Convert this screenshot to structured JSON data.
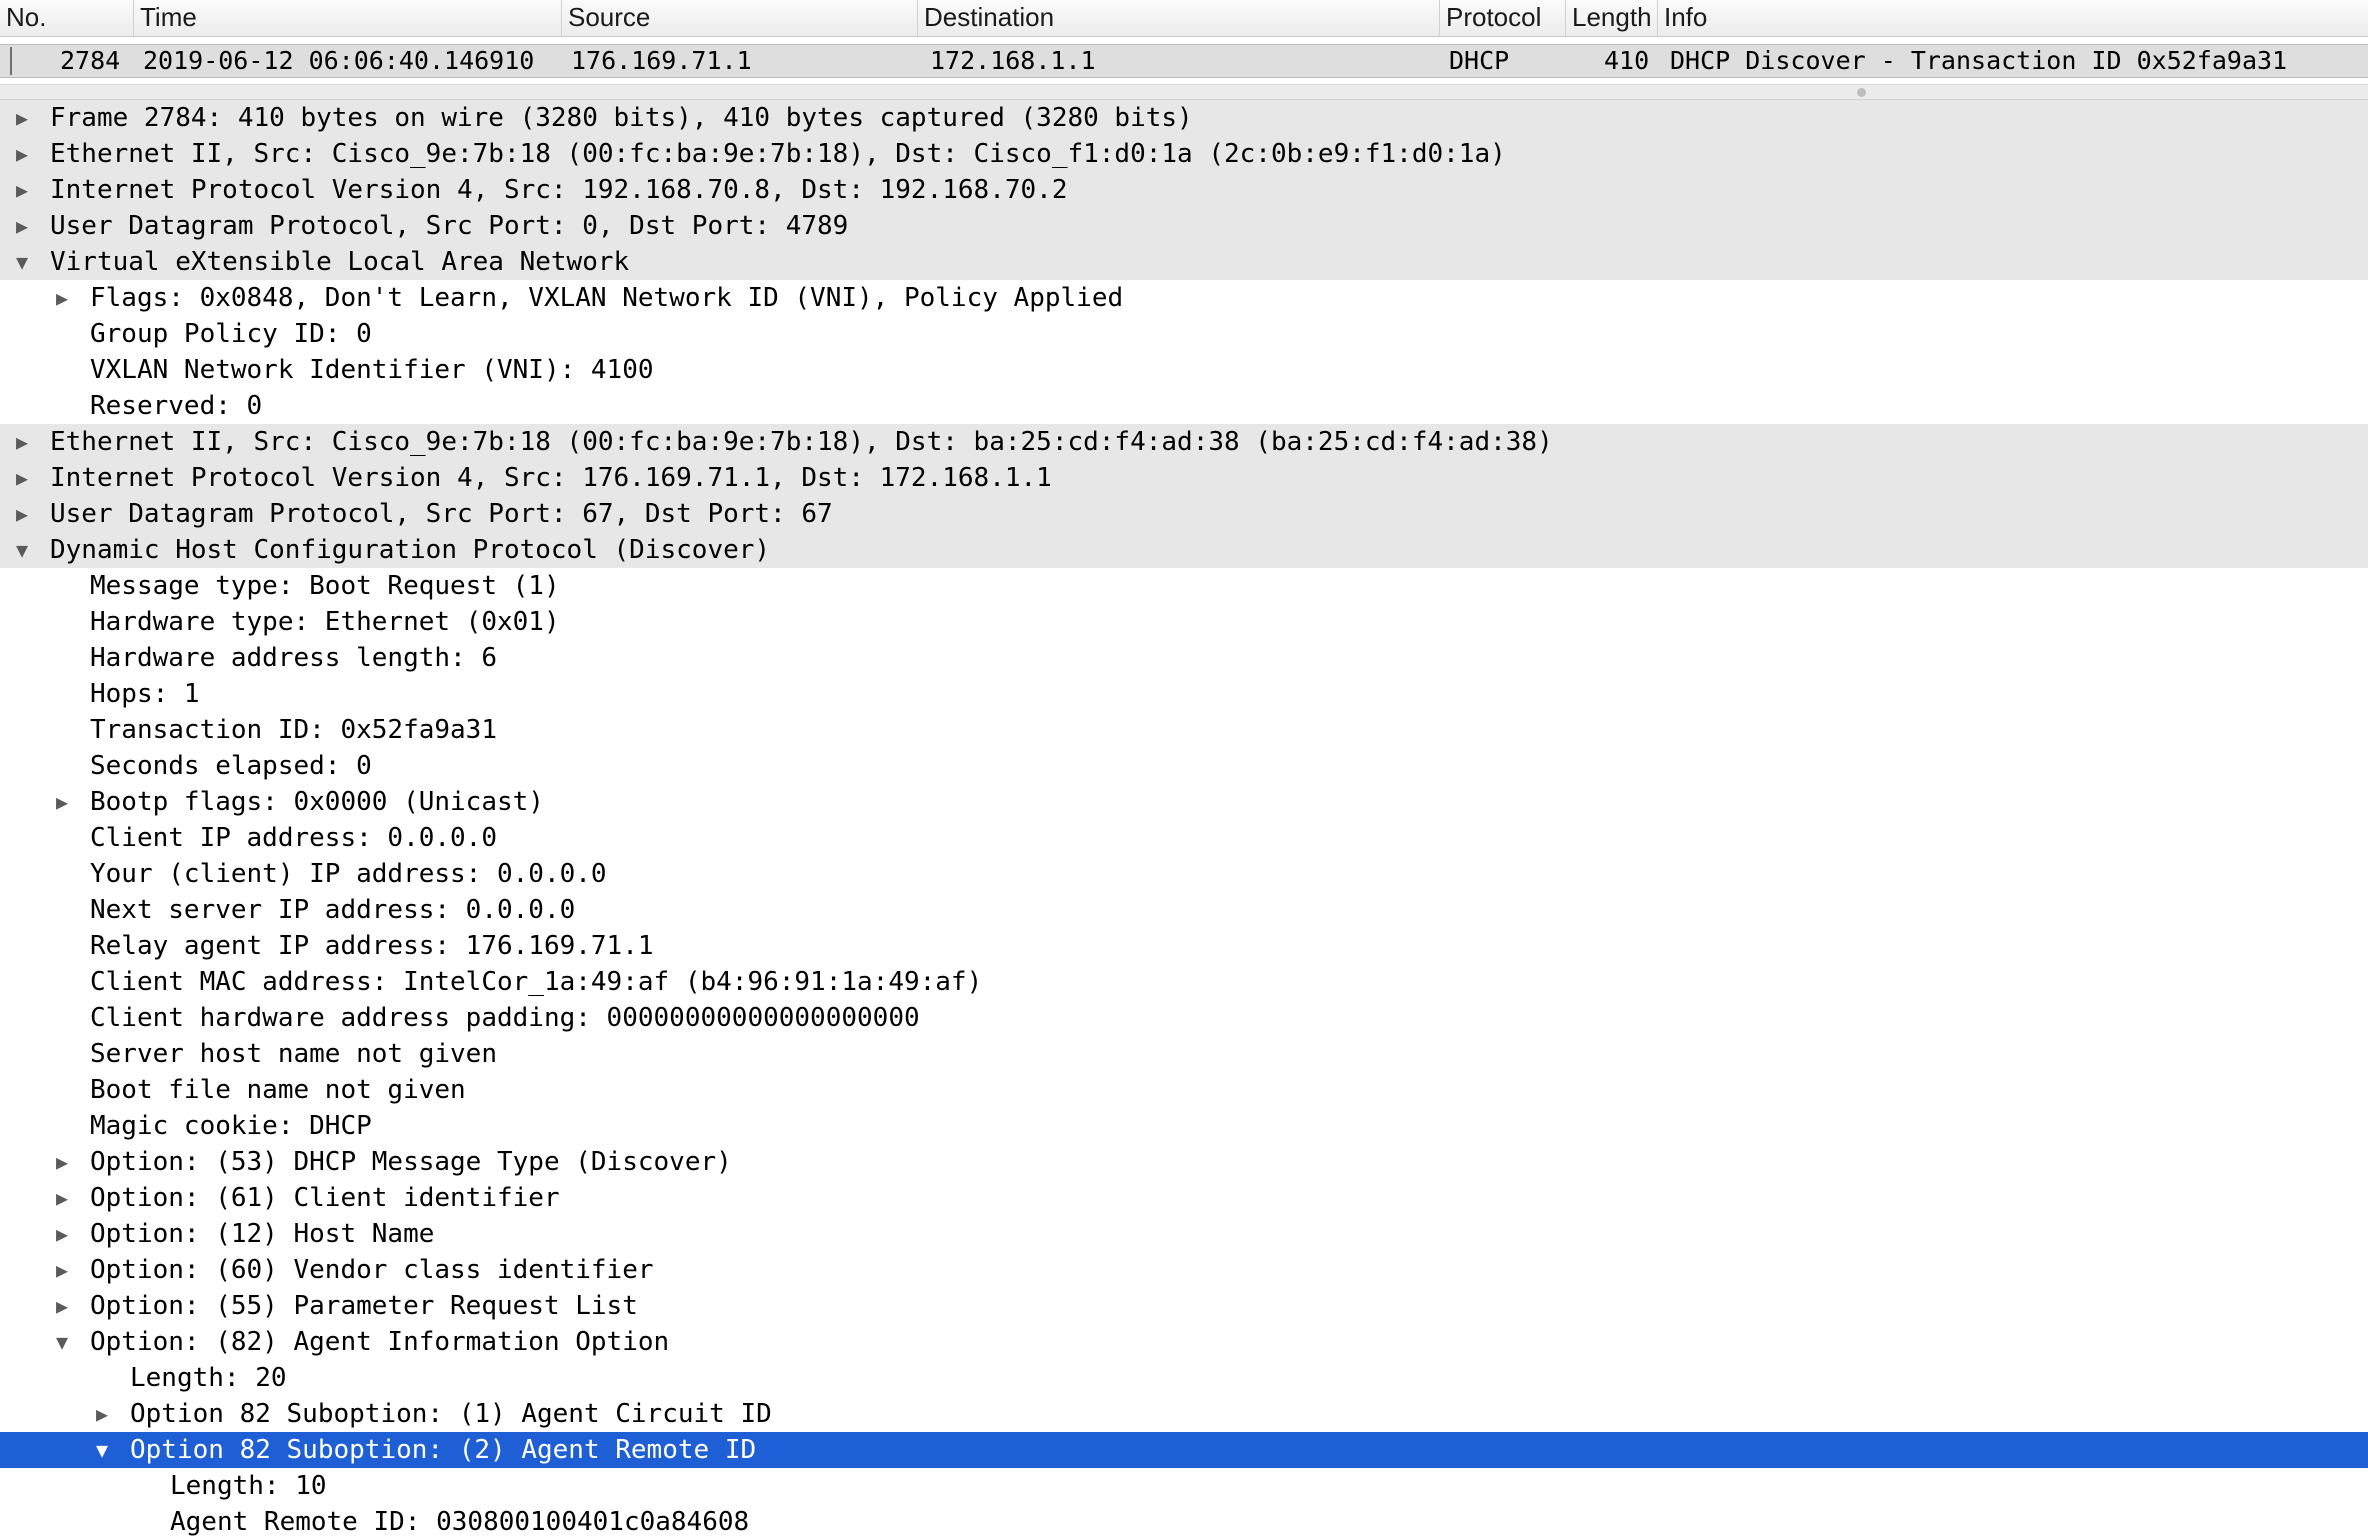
{
  "columns": {
    "no": "No.",
    "time": "Time",
    "source": "Source",
    "destination": "Destination",
    "protocol": "Protocol",
    "length": "Length",
    "info": "Info"
  },
  "packet": {
    "no": "2784",
    "time": "2019-06-12 06:06:40.146910",
    "source": "176.169.71.1",
    "destination": "172.168.1.1",
    "protocol": "DHCP",
    "length": "410",
    "info": "DHCP Discover - Transaction ID 0x52fa9a31"
  },
  "icons": {
    "collapsed": "▶",
    "expanded": "▼"
  },
  "tree": [
    {
      "text": "Frame 2784: 410 bytes on wire (3280 bits), 410 bytes captured (3280 bits)",
      "expander": "collapsed"
    },
    {
      "text": "Ethernet II, Src: Cisco_9e:7b:18 (00:fc:ba:9e:7b:18), Dst: Cisco_f1:d0:1a (2c:0b:e9:f1:d0:1a)",
      "expander": "collapsed"
    },
    {
      "text": "Internet Protocol Version 4, Src: 192.168.70.8, Dst: 192.168.70.2",
      "expander": "collapsed"
    },
    {
      "text": "User Datagram Protocol, Src Port: 0, Dst Port: 4789",
      "expander": "collapsed"
    },
    {
      "text": "Virtual eXtensible Local Area Network",
      "expander": "expanded"
    },
    {
      "text": "Flags: 0x0848, Don't Learn, VXLAN Network ID (VNI), Policy Applied",
      "expander": "collapsed"
    },
    {
      "text": "Group Policy ID: 0",
      "expander": "none"
    },
    {
      "text": "VXLAN Network Identifier (VNI): 4100",
      "expander": "none"
    },
    {
      "text": "Reserved: 0",
      "expander": "none"
    },
    {
      "text": "Ethernet II, Src: Cisco_9e:7b:18 (00:fc:ba:9e:7b:18), Dst: ba:25:cd:f4:ad:38 (ba:25:cd:f4:ad:38)",
      "expander": "collapsed"
    },
    {
      "text": "Internet Protocol Version 4, Src: 176.169.71.1, Dst: 172.168.1.1",
      "expander": "collapsed"
    },
    {
      "text": "User Datagram Protocol, Src Port: 67, Dst Port: 67",
      "expander": "collapsed"
    },
    {
      "text": "Dynamic Host Configuration Protocol (Discover)",
      "expander": "expanded"
    },
    {
      "text": "Message type: Boot Request (1)",
      "expander": "none"
    },
    {
      "text": "Hardware type: Ethernet (0x01)",
      "expander": "none"
    },
    {
      "text": "Hardware address length: 6",
      "expander": "none"
    },
    {
      "text": "Hops: 1",
      "expander": "none"
    },
    {
      "text": "Transaction ID: 0x52fa9a31",
      "expander": "none"
    },
    {
      "text": "Seconds elapsed: 0",
      "expander": "none"
    },
    {
      "text": "Bootp flags: 0x0000 (Unicast)",
      "expander": "collapsed"
    },
    {
      "text": "Client IP address: 0.0.0.0",
      "expander": "none"
    },
    {
      "text": "Your (client) IP address: 0.0.0.0",
      "expander": "none"
    },
    {
      "text": "Next server IP address: 0.0.0.0",
      "expander": "none"
    },
    {
      "text": "Relay agent IP address: 176.169.71.1",
      "expander": "none"
    },
    {
      "text": "Client MAC address: IntelCor_1a:49:af (b4:96:91:1a:49:af)",
      "expander": "none"
    },
    {
      "text": "Client hardware address padding: 00000000000000000000",
      "expander": "none"
    },
    {
      "text": "Server host name not given",
      "expander": "none"
    },
    {
      "text": "Boot file name not given",
      "expander": "none"
    },
    {
      "text": "Magic cookie: DHCP",
      "expander": "none"
    },
    {
      "text": "Option: (53) DHCP Message Type (Discover)",
      "expander": "collapsed"
    },
    {
      "text": "Option: (61) Client identifier",
      "expander": "collapsed"
    },
    {
      "text": "Option: (12) Host Name",
      "expander": "collapsed"
    },
    {
      "text": "Option: (60) Vendor class identifier",
      "expander": "collapsed"
    },
    {
      "text": "Option: (55) Parameter Request List",
      "expander": "collapsed"
    },
    {
      "text": "Option: (82) Agent Information Option",
      "expander": "expanded"
    },
    {
      "text": "Length: 20",
      "expander": "none"
    },
    {
      "text": "Option 82 Suboption: (1) Agent Circuit ID",
      "expander": "collapsed"
    },
    {
      "text": "Option 82 Suboption: (2) Agent Remote ID",
      "expander": "expanded",
      "selected": true
    },
    {
      "text": "Length: 10",
      "expander": "none"
    },
    {
      "text": "Agent Remote ID: 030800100401c0a84608",
      "expander": "none"
    }
  ]
}
